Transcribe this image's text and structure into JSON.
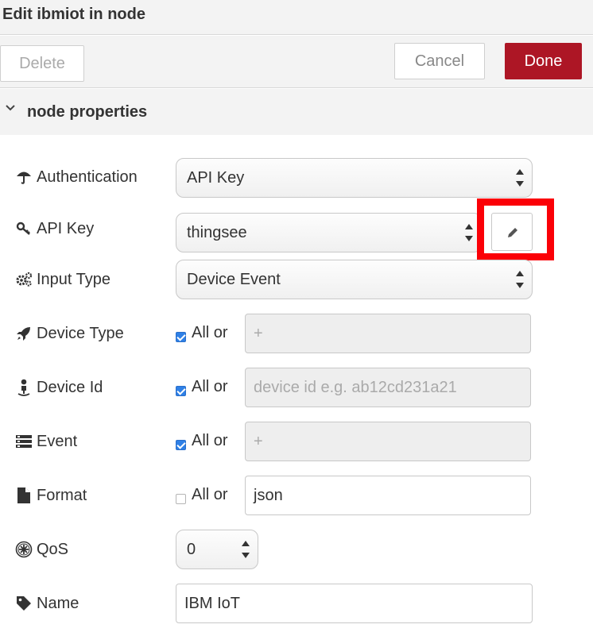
{
  "title": "Edit ibmiot in node",
  "toolbar": {
    "delete_label": "Delete",
    "cancel_label": "Cancel",
    "done_label": "Done"
  },
  "section": {
    "title": "node properties",
    "icon": "chevron-down-icon"
  },
  "fields": {
    "authentication": {
      "label": "Authentication",
      "icon": "umbrella-icon",
      "value": "API Key"
    },
    "api_key": {
      "label": "API Key",
      "icon": "key-icon",
      "value": "thingsee",
      "edit_icon": "pencil-icon"
    },
    "input_type": {
      "label": "Input Type",
      "icon": "gears-icon",
      "value": "Device Event"
    },
    "device_type": {
      "label": "Device Type",
      "icon": "rocket-icon",
      "all_checked": true,
      "all_label": "All or",
      "placeholder": "+"
    },
    "device_id": {
      "label": "Device Id",
      "icon": "user-icon",
      "all_checked": true,
      "all_label": "All or",
      "placeholder": "device id e.g. ab12cd231a21"
    },
    "event": {
      "label": "Event",
      "icon": "server-icon",
      "all_checked": true,
      "all_label": "All or",
      "placeholder": "+"
    },
    "format": {
      "label": "Format",
      "icon": "file-icon",
      "all_checked": false,
      "all_label": "All or",
      "value": "json"
    },
    "qos": {
      "label": "QoS",
      "icon": "qos-icon",
      "value": "0"
    },
    "name": {
      "label": "Name",
      "icon": "tag-icon",
      "value": "IBM IoT"
    }
  },
  "colors": {
    "done_button": "#ad1625",
    "highlight": "#fb0007",
    "checkbox": "#2f80e6"
  }
}
